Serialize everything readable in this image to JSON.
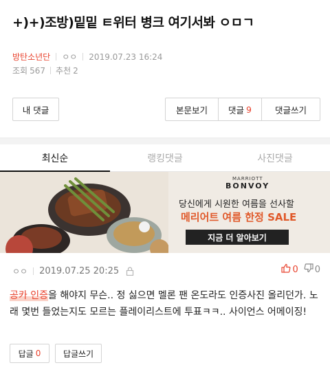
{
  "post": {
    "title": "+)+)조방)밑밑 ㅌ위터 병크 여기서봐 ㅇㅁㄱ",
    "board": "방탄소년단",
    "author": "ㅇㅇ",
    "datetime": "2019.07.23 16:24",
    "views_label": "조회",
    "views": "567",
    "recommend_label": "추천",
    "recommend": "2"
  },
  "buttons": {
    "my_comments": "내 댓글",
    "view_post": "본문보기",
    "comments_label": "댓글",
    "comments_count": "9",
    "write_comment": "댓글쓰기"
  },
  "tabs": [
    {
      "label": "최신순",
      "active": true
    },
    {
      "label": "랭킹댓글",
      "active": false
    },
    {
      "label": "사진댓글",
      "active": false
    }
  ],
  "ad": {
    "brand_top": "MARRIOTT",
    "brand": "BONVOY",
    "line1": "당신에게 시원한 여름을 선사할",
    "line2": "메리어트 여름 한정 SALE",
    "cta": "지금 더 알아보기"
  },
  "comment": {
    "author": "ㅇㅇ",
    "date": "2019.07.25 20:25",
    "upvotes": "0",
    "downvotes": "0",
    "highlight": "공카 인증",
    "text": "을 해야지 무슨.. 정 싫으면 멜론 팬 온도라도 인증사진 올리던가. 노래 몇번 들었는지도 모르는 플레이리스트에 투표ㅋㅋ.. 사이언스 어메이징!",
    "reply_label": "답글",
    "reply_count": "0",
    "write_reply": "답글쓰기"
  },
  "colors": {
    "accent": "#e8412c",
    "ad_accent": "#e0592a"
  }
}
